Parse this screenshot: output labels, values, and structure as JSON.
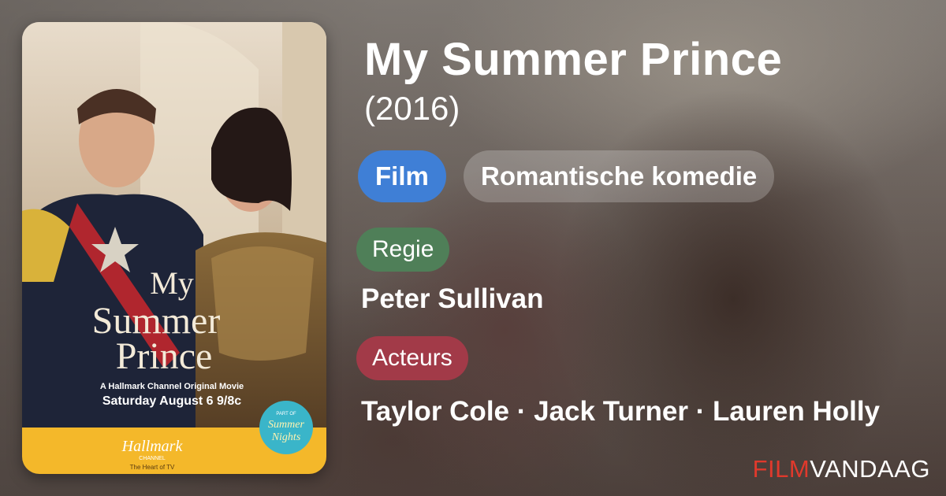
{
  "movie": {
    "title": "My Summer Prince",
    "year": "(2016)"
  },
  "tags": {
    "type": "Film",
    "genre": "Romantische komedie"
  },
  "director": {
    "label": "Regie",
    "name": "Peter Sullivan"
  },
  "cast": {
    "label": "Acteurs",
    "names": "Taylor Cole · Jack Turner · Lauren Holly"
  },
  "poster": {
    "title_line1": "My",
    "title_line2": "Summer",
    "title_line3": "Prince",
    "tagline": "A Hallmark Channel Original Movie",
    "airdate": "Saturday August 6 9/8c",
    "channel": "Hallmark",
    "channel_sub": "CHANNEL",
    "channel_slogan": "The Heart of TV",
    "badge_top": "PART OF",
    "badge_line1": "Summer",
    "badge_line2": "Nights"
  },
  "brand": {
    "part1": "FILM",
    "part2": "VANDAAG"
  },
  "colors": {
    "film_pill": "#3f7fd6",
    "regie_pill": "#4f7f58",
    "acteurs_pill": "#a23a48",
    "brand_red": "#e0392c",
    "poster_yellow": "#f4b82a"
  }
}
